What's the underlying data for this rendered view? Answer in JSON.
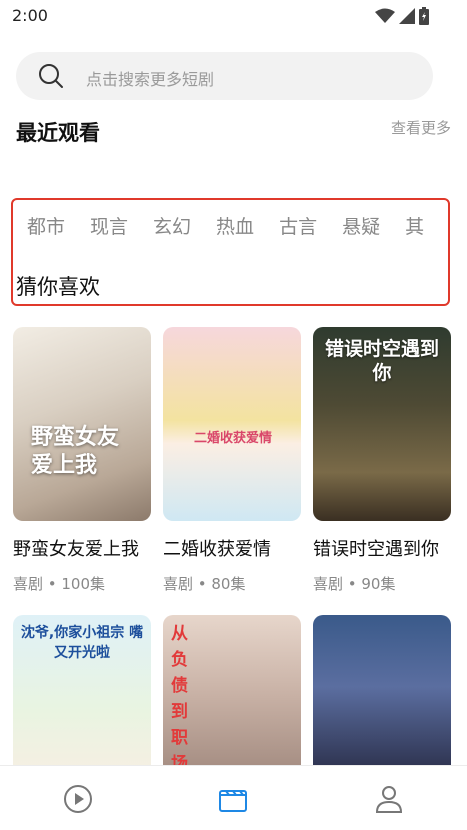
{
  "status": {
    "time": "2:00"
  },
  "search": {
    "placeholder": "点击搜索更多短剧"
  },
  "recent": {
    "title": "最近观看",
    "more": "查看更多"
  },
  "genres": [
    "都市",
    "现言",
    "玄幻",
    "热血",
    "古言",
    "悬疑",
    "其"
  ],
  "guess_title": "猜你喜欢",
  "cards": [
    {
      "title": "野蛮女友爱上我",
      "meta": "喜剧 • 100集",
      "poster_text": "野蛮女友爱上我"
    },
    {
      "title": "二婚收获爱情",
      "meta": "喜剧 • 80集",
      "poster_text": "二婚收获爱情"
    },
    {
      "title": "错误时空遇到你",
      "meta": "喜剧 • 90集",
      "poster_text": "错误时空遇到你"
    }
  ],
  "lower_cards": [
    {
      "poster_text": "沈爷,你家小祖宗 嘴又开光啦"
    },
    {
      "poster_text": "从负债到职场女"
    },
    {
      "poster_text": ""
    }
  ],
  "nav": [
    {
      "icon": "play-circle-icon"
    },
    {
      "icon": "clapperboard-icon"
    },
    {
      "icon": "person-icon"
    }
  ],
  "colors": {
    "accent": "#1e88e5",
    "highlight": "#e0392b"
  }
}
